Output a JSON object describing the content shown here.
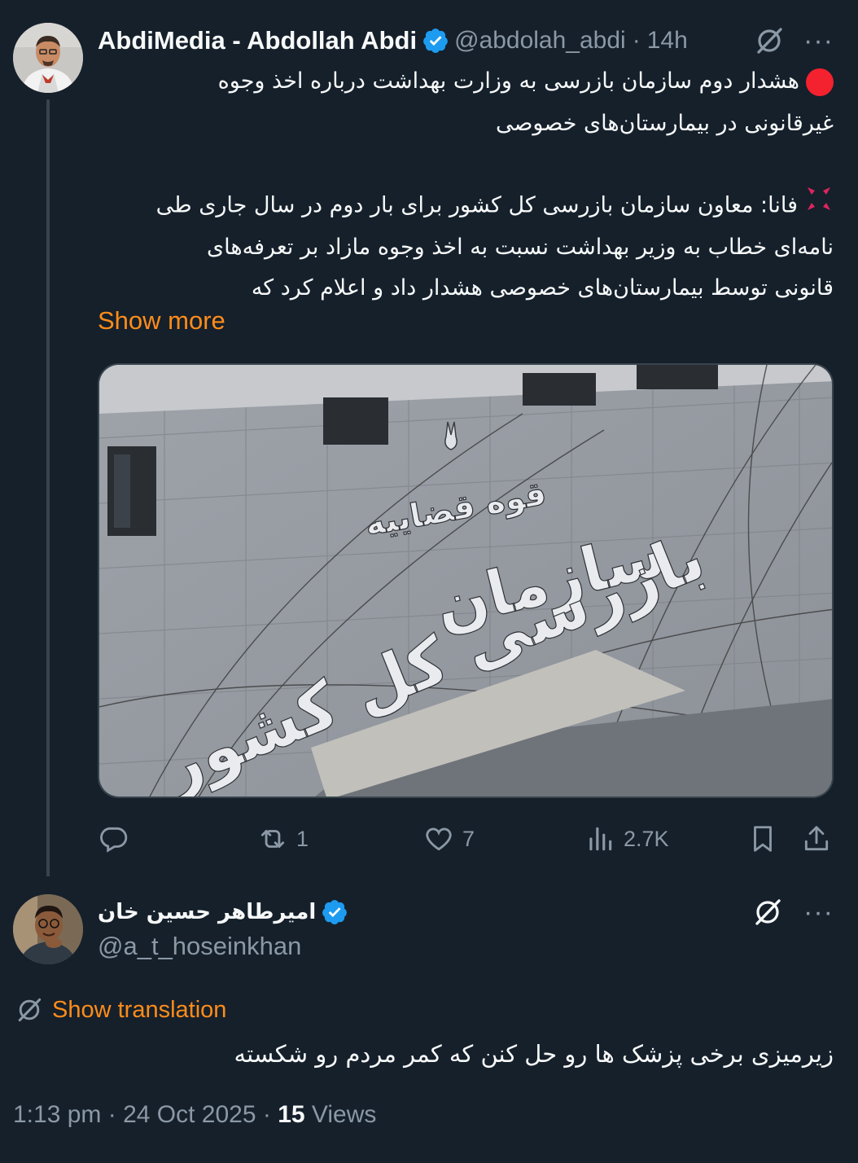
{
  "tweet": {
    "display_name": "AbdiMedia - Abdollah Abdi",
    "handle": "@abdolah_abdi",
    "time": "14h",
    "line1": "هشدار دوم سازمان بازرسی به وزارت بهداشت درباره اخذ وجوه",
    "line2": "غیرقانونی در بیمارستان‌های خصوصی",
    "body_line1": "فانا: معاون سازمان بازرسی کل کشور برای بار دوم در سال جاری طی",
    "body_line2": "نامه‌ای خطاب به وزیر بهداشت نسبت به اخذ وجوه مازاد بر تعرفه‌های",
    "body_line3": "قانونی توسط بیمارستان‌های خصوصی هشدار داد و اعلام کرد که",
    "show_more": "Show more",
    "media": {
      "sign_small": "قوه قضاییه",
      "sign_line1": "سازمان",
      "sign_line2": "بازرسی کل کشور"
    },
    "actions": {
      "replies": "",
      "retweets": "1",
      "likes": "7",
      "views": "2.7K"
    }
  },
  "reply": {
    "display_name": "امیرطاهر حسین خان",
    "handle": "@a_t_hoseinkhan",
    "show_translation": "Show translation",
    "text": "زیرمیزی برخی پزشک ها رو حل کنن که کمر مردم رو شکسته",
    "time": "1:13 pm",
    "date": "24 Oct 2025",
    "views_count": "15",
    "views_label": "Views"
  },
  "icons": {
    "verified": "verified-badge-icon",
    "grok": "grok-icon",
    "more": "more-icon",
    "reply": "reply-icon",
    "retweet": "retweet-icon",
    "like": "heart-icon",
    "views": "views-icon",
    "bookmark": "bookmark-icon",
    "share": "share-icon",
    "angry": "anger-symbol-icon",
    "red_circle": "red-circle-icon"
  },
  "colors": {
    "background": "#15202b",
    "accent": "#ff8c1a",
    "verified": "#1d9bf0",
    "muted": "#8b98a5"
  }
}
